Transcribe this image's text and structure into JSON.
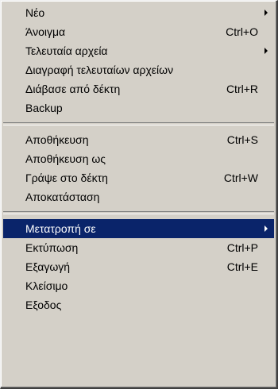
{
  "menu": {
    "groups": [
      [
        {
          "label": "Νέο",
          "shortcut": "",
          "submenu": true
        },
        {
          "label": "Άνοιγμα",
          "shortcut": "Ctrl+O",
          "submenu": false
        },
        {
          "label": "Τελευταία αρχεία",
          "shortcut": "",
          "submenu": true
        },
        {
          "label": "Διαγραφή τελευταίων αρχείων",
          "shortcut": "",
          "submenu": false
        },
        {
          "label": "Διάβασε από δέκτη",
          "shortcut": "Ctrl+R",
          "submenu": false
        },
        {
          "label": "Backup",
          "shortcut": "",
          "submenu": false
        }
      ],
      [
        {
          "label": "Αποθήκευση",
          "shortcut": "Ctrl+S",
          "submenu": false
        },
        {
          "label": "Αποθήκευση ως",
          "shortcut": "",
          "submenu": false
        },
        {
          "label": "Γράψε στο δέκτη",
          "shortcut": "Ctrl+W",
          "submenu": false
        },
        {
          "label": "Αποκατάσταση",
          "shortcut": "",
          "submenu": false
        }
      ],
      [
        {
          "label": "Μετατροπή σε",
          "shortcut": "",
          "submenu": true,
          "selected": true
        },
        {
          "label": "Εκτύπωση",
          "shortcut": "Ctrl+P",
          "submenu": false
        },
        {
          "label": "Εξαγωγή",
          "shortcut": "Ctrl+E",
          "submenu": false
        },
        {
          "label": "Κλείσιμο",
          "shortcut": "",
          "submenu": false
        },
        {
          "label": "Εξοδος",
          "shortcut": "",
          "submenu": false
        }
      ]
    ],
    "colors": {
      "face": "#d4d0c8",
      "highlight": "#0a246a",
      "highlight_text": "#ffffff"
    }
  }
}
